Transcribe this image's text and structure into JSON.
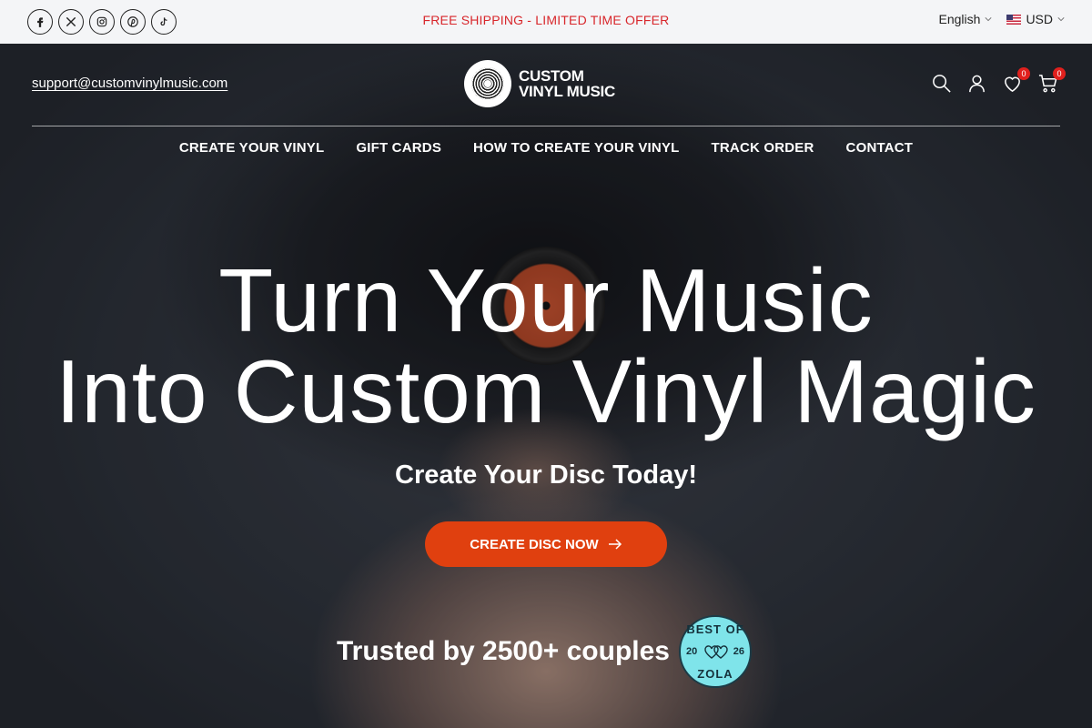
{
  "topbar": {
    "socials": [
      "facebook-icon",
      "x-icon",
      "instagram-icon",
      "pinterest-icon",
      "tiktok-icon"
    ],
    "promo": "FREE SHIPPING - LIMITED TIME OFFER",
    "language": "English",
    "currency": "USD"
  },
  "header": {
    "email": "support@customvinylmusic.com",
    "logo_line1": "CUSTOM",
    "logo_line2": "VINYL MUSIC",
    "wishlist_count": "0",
    "cart_count": "0"
  },
  "nav": {
    "items": [
      {
        "label": "CREATE YOUR VINYL"
      },
      {
        "label": "GIFT CARDS"
      },
      {
        "label": "HOW TO CREATE YOUR VINYL"
      },
      {
        "label": "TRACK ORDER"
      },
      {
        "label": "CONTACT"
      }
    ]
  },
  "hero": {
    "headline_line1": "Turn Your Music",
    "headline_line2": "Into Custom Vinyl Magic",
    "subheadline": "Create Your Disc Today!",
    "cta_label": "CREATE DISC NOW",
    "trusted_text": "Trusted by 2500+ couples",
    "badge_top": "BEST OF",
    "badge_bottom": "ZOLA",
    "badge_year_left": "20",
    "badge_year_right": "26"
  },
  "colors": {
    "promo": "#d8262b",
    "cta": "#e0400f",
    "badge": "#e0201d",
    "zola_badge": "#7fe4ea"
  }
}
